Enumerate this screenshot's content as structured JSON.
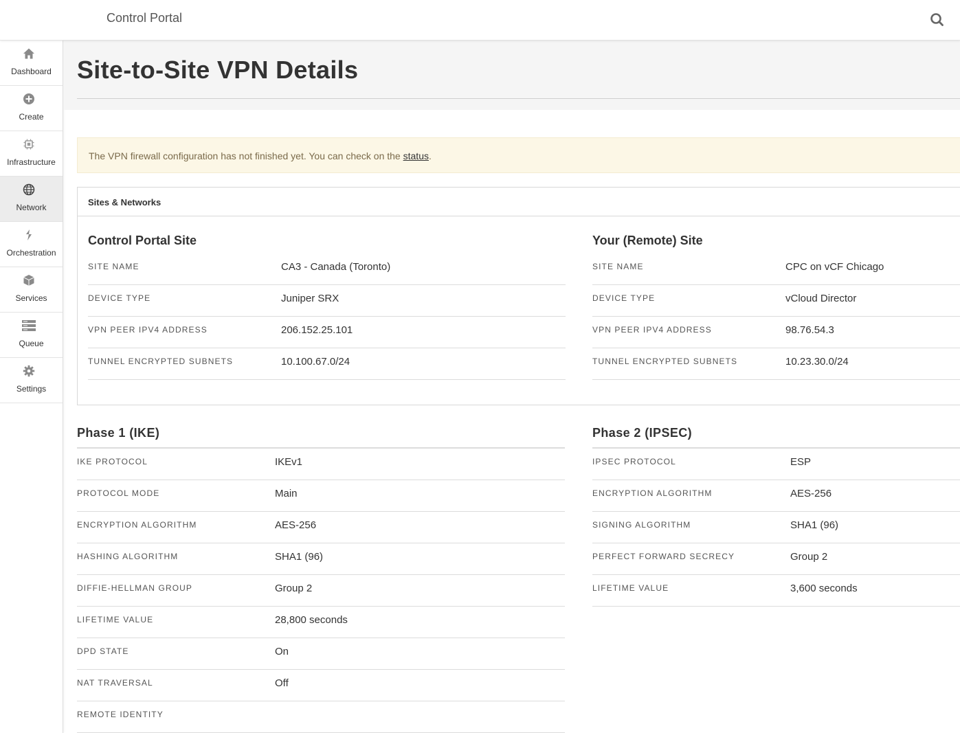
{
  "header": {
    "app_title": "Control Portal",
    "search_icon": "search-icon"
  },
  "sidebar": {
    "items": [
      {
        "label": "Dashboard",
        "icon": "home-icon"
      },
      {
        "label": "Create",
        "icon": "plus-circle-icon"
      },
      {
        "label": "Infrastructure",
        "icon": "chip-icon"
      },
      {
        "label": "Network",
        "icon": "globe-icon",
        "active": true
      },
      {
        "label": "Orchestration",
        "icon": "flow-icon"
      },
      {
        "label": "Services",
        "icon": "cube-icon"
      },
      {
        "label": "Queue",
        "icon": "queue-icon"
      },
      {
        "label": "Settings",
        "icon": "gear-icon"
      }
    ]
  },
  "page": {
    "title": "Site-to-Site VPN Details"
  },
  "alert": {
    "text": "The VPN firewall configuration has not finished yet. You can check on the ",
    "link": "status",
    "suffix": "."
  },
  "sites": {
    "heading": "Sites & Networks",
    "local": {
      "title": "Control Portal Site",
      "rows": [
        {
          "key": "Site Name",
          "value": "CA3 - Canada (Toronto)"
        },
        {
          "key": "Device Type",
          "value": "Juniper SRX"
        },
        {
          "key": "VPN Peer IPv4 Address",
          "value": "206.152.25.101"
        },
        {
          "key": "Tunnel Encrypted Subnets",
          "value": "10.100.67.0/24"
        }
      ]
    },
    "remote": {
      "title": "Your (Remote) Site",
      "rows": [
        {
          "key": "Site Name",
          "value": "CPC on vCF Chicago"
        },
        {
          "key": "Device Type",
          "value": "vCloud Director"
        },
        {
          "key": "VPN Peer IPv4 Address",
          "value": "98.76.54.3"
        },
        {
          "key": "Tunnel Encrypted Subnets",
          "value": "10.23.30.0/24"
        }
      ]
    }
  },
  "phase1": {
    "title": "Phase 1 (IKE)",
    "rows": [
      {
        "key": "IKE Protocol",
        "value": "IKEv1"
      },
      {
        "key": "Protocol Mode",
        "value": "Main"
      },
      {
        "key": "Encryption Algorithm",
        "value": "AES-256"
      },
      {
        "key": "Hashing Algorithm",
        "value": "SHA1 (96)"
      },
      {
        "key": "Diffie-Hellman Group",
        "value": "Group 2"
      },
      {
        "key": "Lifetime Value",
        "value": "28,800 seconds"
      },
      {
        "key": "DPD State",
        "value": "On"
      },
      {
        "key": "NAT Traversal",
        "value": "Off"
      },
      {
        "key": "Remote Identity",
        "value": ""
      }
    ]
  },
  "phase2": {
    "title": "Phase 2 (IPSEC)",
    "rows": [
      {
        "key": "IPSEC Protocol",
        "value": "ESP"
      },
      {
        "key": "Encryption Algorithm",
        "value": "AES-256"
      },
      {
        "key": "Signing Algorithm",
        "value": "SHA1 (96)"
      },
      {
        "key": "Perfect Forward Secrecy",
        "value": "Group 2"
      },
      {
        "key": "Lifetime Value",
        "value": "3,600 seconds"
      }
    ]
  }
}
